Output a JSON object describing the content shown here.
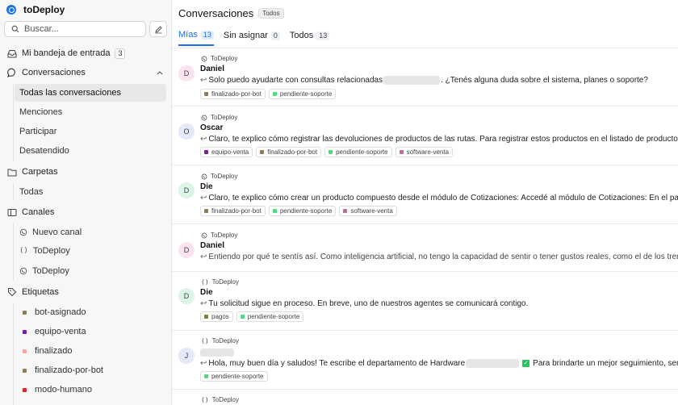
{
  "app": {
    "name": "toDeploy"
  },
  "search": {
    "placeholder": "Buscar..."
  },
  "nav": {
    "inbox": {
      "label": "Mi bandeja de entrada",
      "count": "3"
    },
    "conversations": {
      "label": "Conversaciones",
      "items": [
        "Todas las conversaciones",
        "Menciones",
        "Participar",
        "Desatendido"
      ]
    },
    "folders": {
      "label": "Carpetas",
      "items": [
        "Todas"
      ]
    },
    "channels": {
      "label": "Canales",
      "items": [
        {
          "label": "Nuevo canal",
          "icon": "whatsapp-icon"
        },
        {
          "label": "ToDeploy",
          "icon": "code-brackets-icon"
        },
        {
          "label": "ToDeploy",
          "icon": "whatsapp-icon"
        }
      ]
    },
    "tags": {
      "label": "Etiquetas",
      "items": [
        {
          "label": "bot-asignado",
          "color": "#8a7a5c"
        },
        {
          "label": "equipo-venta",
          "color": "#7b1fa2"
        },
        {
          "label": "finalizado",
          "color": "#f4a6a6"
        },
        {
          "label": "finalizado-por-bot",
          "color": "#8d7b5b"
        },
        {
          "label": "modo-humano",
          "color": "#dc2626"
        }
      ]
    }
  },
  "header": {
    "title": "Conversaciones",
    "filter": "Todos"
  },
  "tabs": [
    {
      "label": "Mías",
      "count": "13"
    },
    {
      "label": "Sin asignar",
      "count": "0"
    },
    {
      "label": "Todos",
      "count": "13"
    }
  ],
  "label_colors": {
    "finalizado-por-bot": "#8d7b5b",
    "pendiente-soporte": "#4ade80",
    "equipo-venta": "#7b1fa2",
    "software-venta": "#c26a9a",
    "pagos": "#8a7a3c"
  },
  "conversations": [
    {
      "channel": "ToDeploy",
      "channel_icon": "whatsapp-icon",
      "initial": "D",
      "name": "Daniel",
      "msg_a": "Solo puedo ayudarte con consultas relacionadas",
      "msg_b": ". ¿Tenés alguna duda sobre el sistema, planes o soporte?",
      "labels": [
        "finalizado-por-bot",
        "pendiente-soporte"
      ]
    },
    {
      "channel": "ToDeploy",
      "channel_icon": "whatsapp-icon",
      "initial": "O",
      "name": "Oscar",
      "msg_a": "Claro, te explico cómo registrar las devoluciones de productos de las rutas. Para registrar estos productos en el listado de producto",
      "labels": [
        "equipo-venta",
        "finalizado-por-bot",
        "pendiente-soporte",
        "software-venta"
      ]
    },
    {
      "channel": "ToDeploy",
      "channel_icon": "whatsapp-icon",
      "initial": "D",
      "name": "Die",
      "msg_a": "Claro, te explico cómo crear un producto compuesto desde el módulo de Cotizaciones: Accedé al módulo de Cotizaciones: En el pa",
      "labels": [
        "finalizado-por-bot",
        "pendiente-soporte",
        "software-venta"
      ]
    },
    {
      "channel": "ToDeploy",
      "channel_icon": "whatsapp-icon",
      "initial": "D",
      "name": "Daniel",
      "msg_a": "Entiendo por qué te sentís así. Como inteligencia artificial, no tengo la capacidad de sentir o tener gustos reales, como el de los tren",
      "labels": []
    },
    {
      "channel": "ToDeploy",
      "channel_icon": "code-brackets-icon",
      "initial": "D",
      "name": "Die",
      "msg_a": "Tu solicitud sigue en proceso. En breve, uno de nuestros agentes se comunicará contigo.",
      "labels": [
        "pagos",
        "pendiente-soporte"
      ]
    },
    {
      "channel": "ToDeploy",
      "channel_icon": "code-brackets-icon",
      "initial": "J",
      "msg_a": "Hola, muy buen día y saludos! Te escribe el departamento de Hardware",
      "msg_b": "Para brindarte un mejor seguimiento, sera",
      "labels": [
        "pendiente-soporte"
      ]
    },
    {
      "channel": "ToDeploy",
      "channel_icon": "code-brackets-icon"
    }
  ]
}
